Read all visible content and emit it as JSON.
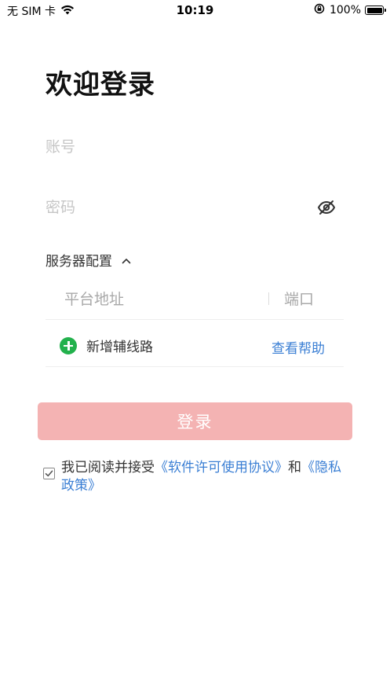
{
  "status_bar": {
    "carrier": "无 SIM 卡",
    "time": "10:19",
    "battery": "100%"
  },
  "page": {
    "title": "欢迎登录"
  },
  "form": {
    "account_placeholder": "账号",
    "password_placeholder": "密码"
  },
  "server": {
    "section_label": "服务器配置",
    "address_placeholder": "平台地址",
    "port_placeholder": "端口",
    "add_route_label": "新增辅线路",
    "help_label": "查看帮助"
  },
  "login": {
    "button_label": "登录"
  },
  "agreement": {
    "prefix": "我已阅读并接受",
    "license_link": "《软件许可使用协议》",
    "conjunction": "和",
    "privacy_link": "《隐私政策》",
    "checked": true
  },
  "colors": {
    "accent_link": "#3b7fd4",
    "login_button_disabled": "#f4b3b3",
    "add_icon": "#22b14c"
  },
  "icons": {
    "wifi": "wifi-icon",
    "orientation_lock": "orientation-lock-icon",
    "battery": "battery-icon",
    "password_toggle": "eye-off-icon",
    "collapse": "chevron-up-icon",
    "add": "plus-circle-icon",
    "checkbox": "checkbox-checked-icon"
  }
}
